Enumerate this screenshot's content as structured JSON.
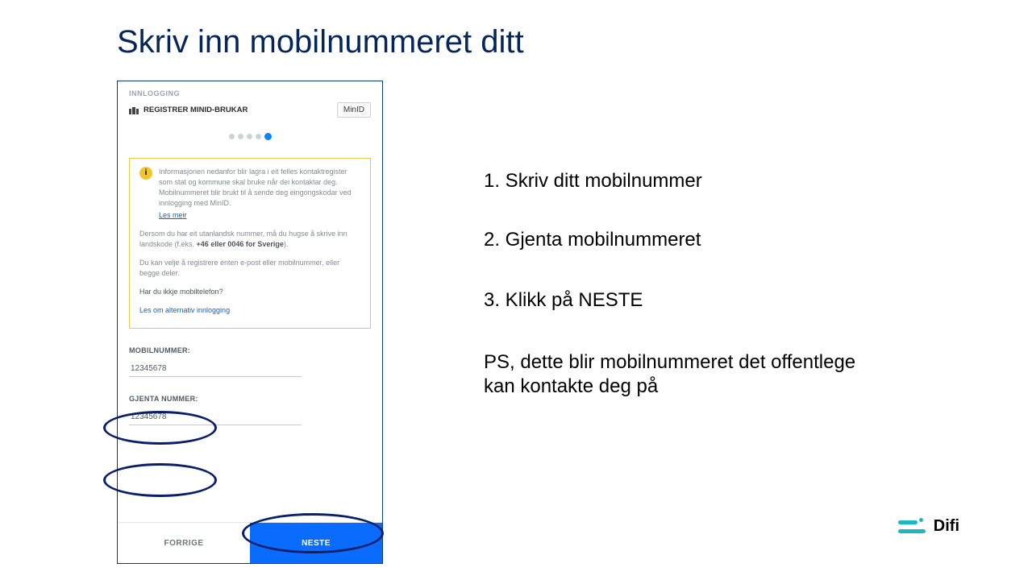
{
  "title": "Skriv inn mobilnummeret ditt",
  "instructions": {
    "s1": "1. Skriv ditt mobilnummer",
    "s2": "2. Gjenta mobilnummeret",
    "s3": "3. Klikk på NESTE",
    "ps": "PS, dette blir mobilnummeret det offentlege kan kontakte deg på"
  },
  "panel": {
    "login_label": "INNLOGGING",
    "register_label": "REGISTRER MINID-BRUKAR",
    "brand": "MinID",
    "info": {
      "p1": "Informasjonen nedanfor blir lagra i eit felles kontaktregister som stat og kommune skal bruke når dei kontaktar deg. Mobilnummeret blir brukt til å sende deg eingongskodar ved innlogging med MinID.",
      "les_meir": "Les meir",
      "p2a": "Dersom du har eit utanlandsk nummer, må du hugse å skrive inn landskode (f.eks. ",
      "p2b": "+46 eller 0046 for Sverige",
      "p2c": ").",
      "p3": "Du kan velje å registrere enten e-post eller mobilnummer, eller begge deler.",
      "q": "Har du ikkje mobiltelefon?",
      "alt": "Les om alternativ innlogging"
    },
    "field1_label": "MOBILNUMMER:",
    "field1_value": "12345678",
    "field2_label": "GJENTA NUMMER:",
    "field2_value": "12345678",
    "btn_prev": "FORRIGE",
    "btn_next": "NESTE"
  },
  "logo": {
    "text": "Difi"
  }
}
